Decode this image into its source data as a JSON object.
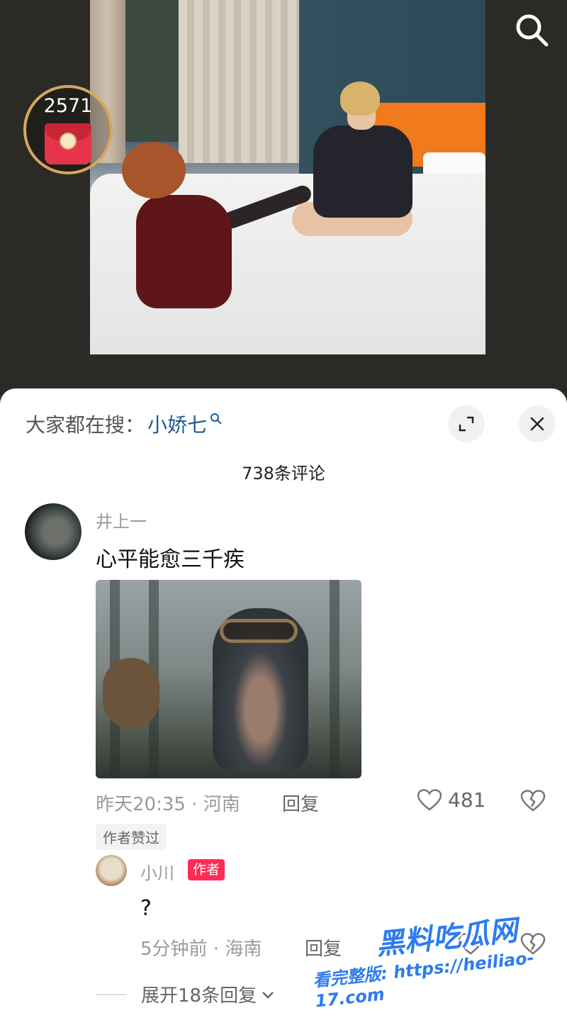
{
  "video": {
    "redpacket_count": "2571"
  },
  "sheet": {
    "search_prefix": "大家都在搜：",
    "search_term": "小娇七",
    "comment_count": "738条评论"
  },
  "comments": [
    {
      "username": "井上一",
      "text": "心平能愈三千疾",
      "time_location": "昨天20:35 · 河南",
      "reply_label": "回复",
      "likes": "481",
      "badge": "作者赞过"
    }
  ],
  "reply": {
    "username": "小川",
    "author_tag": "作者",
    "text": "?",
    "time_location": "5分钟前 · 海南",
    "reply_label": "回复",
    "expand_label": "展开18条回复"
  },
  "watermark": {
    "brand": "黑料吃瓜网",
    "url_text": "看完整版: https://heiliao-17.com"
  },
  "colors": {
    "accent_red": "#fe2c55",
    "search_term_blue": "#1f5a96",
    "video_bg": "#2b2a26"
  },
  "icons": [
    "search-icon",
    "red-envelope-icon",
    "expand-icon",
    "close-icon",
    "heart-icon",
    "broken-heart-icon",
    "chevron-down-icon"
  ]
}
